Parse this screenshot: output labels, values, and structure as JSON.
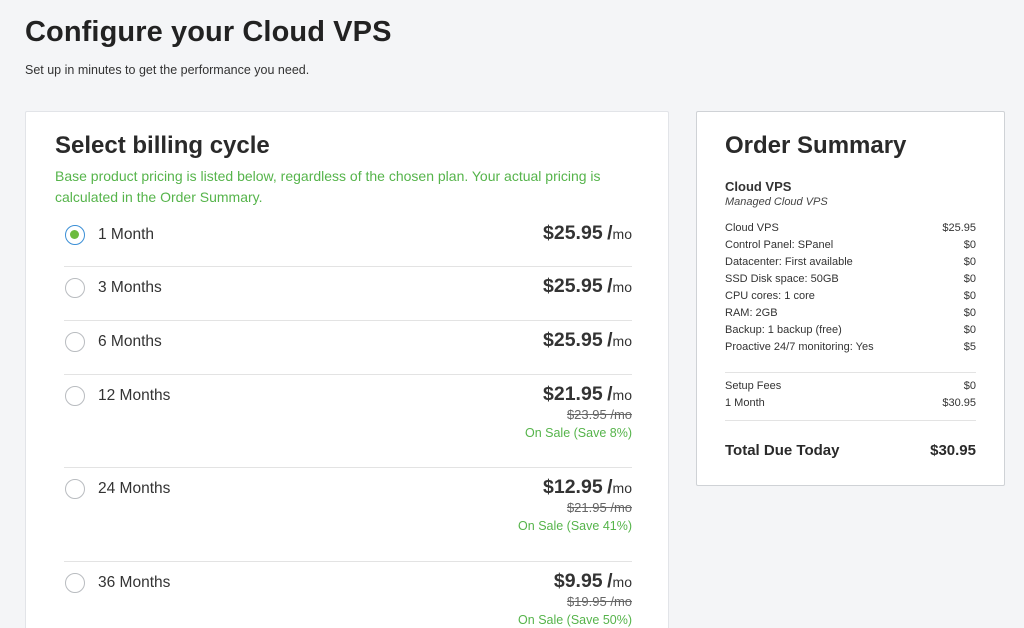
{
  "header": {
    "title": "Configure your Cloud VPS",
    "subtitle": "Set up in minutes to get the performance you need."
  },
  "billing": {
    "title": "Select billing cycle",
    "note": "Base product pricing is listed below, regardless of the chosen plan. Your actual pricing is calculated in the Order Summary.",
    "per_symbol": "/",
    "per_unit": "mo",
    "options": [
      {
        "label": "1 Month",
        "price": "$25.95",
        "old_price": "",
        "sale": "",
        "selected": true
      },
      {
        "label": "3 Months",
        "price": "$25.95",
        "old_price": "",
        "sale": "",
        "selected": false
      },
      {
        "label": "6 Months",
        "price": "$25.95",
        "old_price": "",
        "sale": "",
        "selected": false
      },
      {
        "label": "12 Months",
        "price": "$21.95",
        "old_price": "$23.95 /mo",
        "sale": "On Sale (Save 8%)",
        "selected": false
      },
      {
        "label": "24 Months",
        "price": "$12.95",
        "old_price": "$21.95 /mo",
        "sale": "On Sale (Save 41%)",
        "selected": false
      },
      {
        "label": "36 Months",
        "price": "$9.95",
        "old_price": "$19.95 /mo",
        "sale": "On Sale (Save 50%)",
        "selected": false
      }
    ]
  },
  "summary": {
    "title": "Order Summary",
    "product_name": "Cloud VPS",
    "product_type": "Managed Cloud VPS",
    "lines": [
      {
        "label": "Cloud VPS",
        "value": "$25.95"
      },
      {
        "label": "Control Panel: SPanel",
        "value": "$0"
      },
      {
        "label": "Datacenter: First available",
        "value": "$0"
      },
      {
        "label": "SSD Disk space: 50GB",
        "value": "$0"
      },
      {
        "label": "CPU cores: 1 core",
        "value": "$0"
      },
      {
        "label": "RAM: 2GB",
        "value": "$0"
      },
      {
        "label": "Backup: 1 backup (free)",
        "value": "$0"
      },
      {
        "label": "Proactive 24/7 monitoring: Yes",
        "value": "$5"
      }
    ],
    "fees": [
      {
        "label": "Setup Fees",
        "value": "$0"
      },
      {
        "label": "1 Month",
        "value": "$30.95"
      }
    ],
    "total_label": "Total Due Today",
    "total_value": "$30.95"
  },
  "colors": {
    "accent_green": "#56b44b",
    "radio_fill": "#6dbb3e",
    "radio_selected_border": "#3b8fd6"
  }
}
